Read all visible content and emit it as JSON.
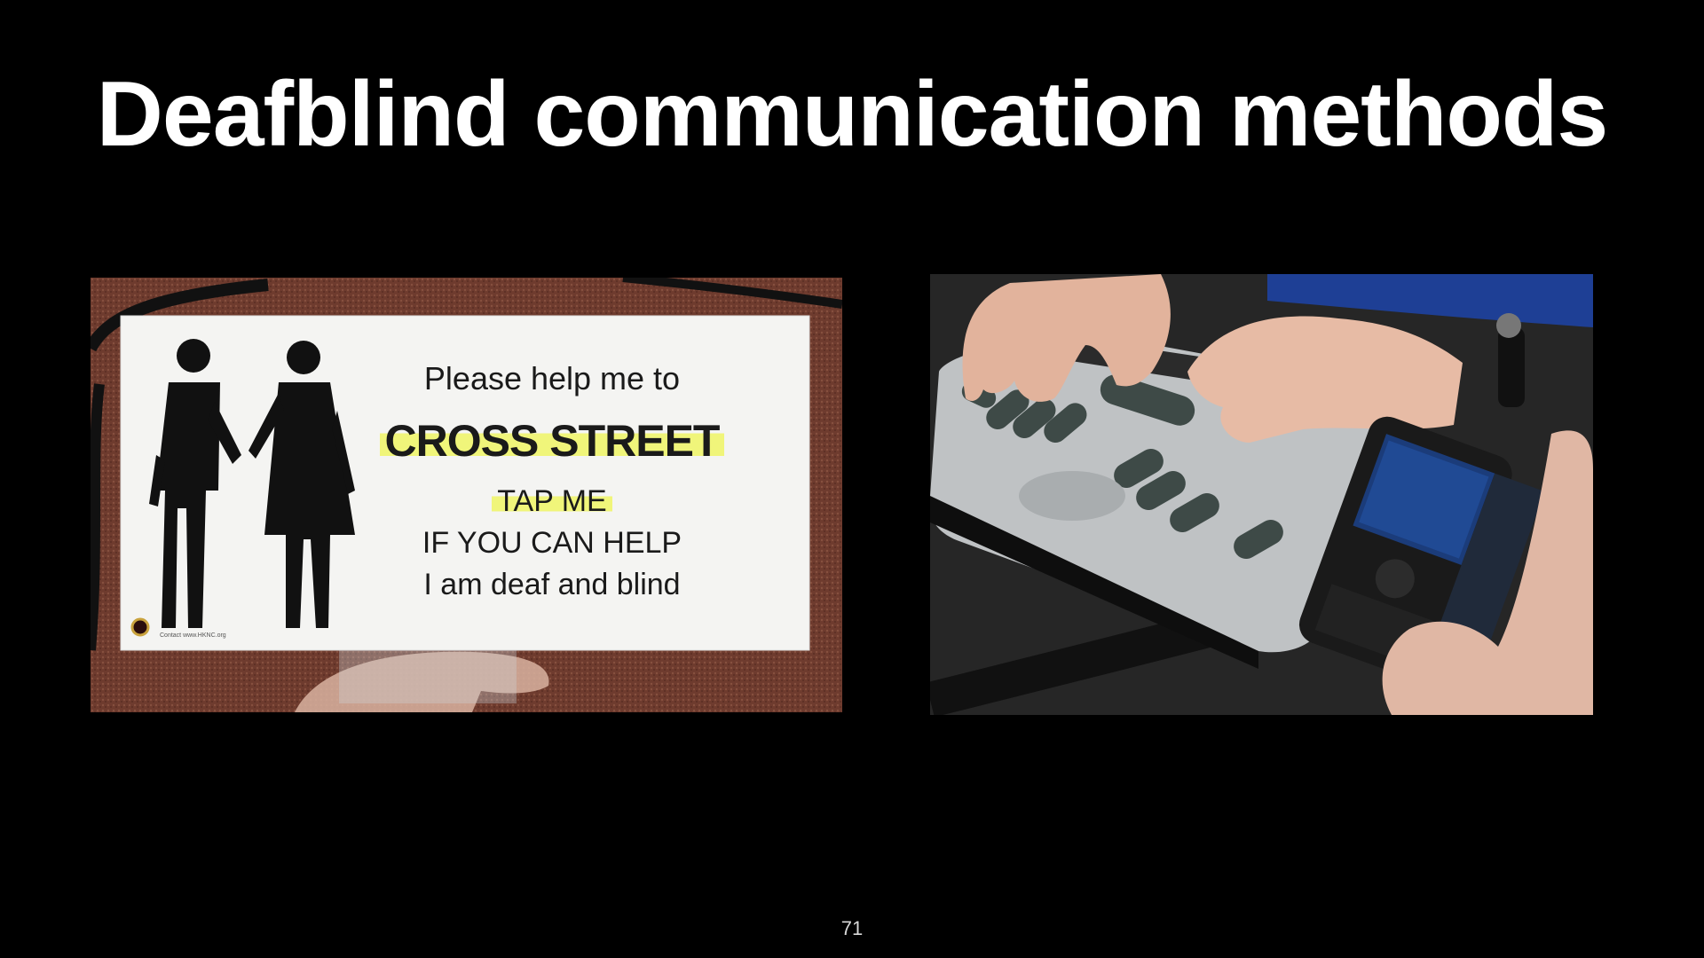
{
  "slide": {
    "title": "Deafblind communication methods",
    "page_number": "71"
  },
  "left_photo": {
    "card_lines": {
      "line1": "Please help me to",
      "line2": "CROSS STREET",
      "line3": "TAP ME",
      "line4": "IF YOU CAN HELP",
      "line5": "I am deaf and blind"
    },
    "contact": "Contact www.HKNC.org"
  },
  "right_photo": {
    "icon": "braille-display-with-phone-photo"
  }
}
